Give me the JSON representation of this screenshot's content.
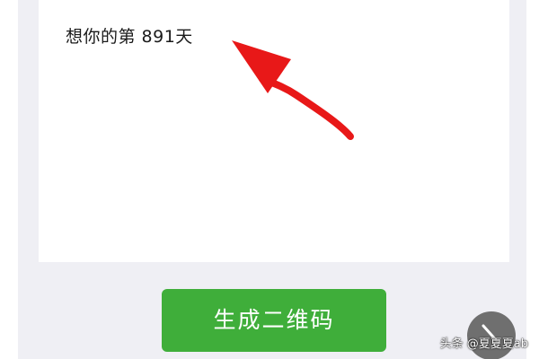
{
  "message": {
    "text": "想你的第 891天"
  },
  "actions": {
    "generate_label": "生成二维码"
  },
  "watermark": {
    "text": "头条 @夏夏夏ab"
  },
  "colors": {
    "button_green": "#3fae3a",
    "annotation_arrow": "#e81818",
    "page_background": "#efeff4"
  },
  "icons": {
    "float_button": "share-icon",
    "annotation": "red-arrow-icon"
  }
}
